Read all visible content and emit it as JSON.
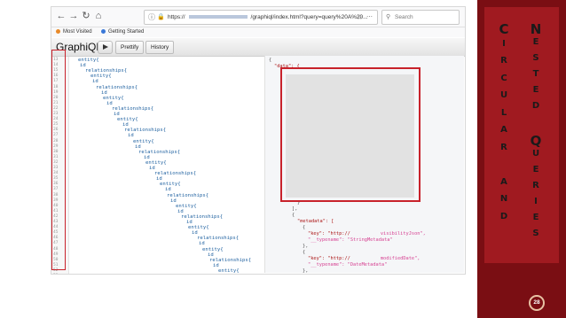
{
  "browser": {
    "url_prefix": "https://",
    "url_suffix": "/graphiql/index.html?query=query%20A%20...",
    "search_placeholder": "Search",
    "bookmarks": [
      "Most Visited",
      "Getting Started"
    ]
  },
  "graphiql": {
    "title": "GraphiQL",
    "prettify_label": "Prettify",
    "history_label": "History"
  },
  "query_lines": [
    {
      "n": "13",
      "code": "entity{"
    },
    {
      "n": "14",
      "code": "id"
    },
    {
      "n": "15",
      "code": "relationships{"
    },
    {
      "n": "16",
      "code": "entity{"
    },
    {
      "n": "17",
      "code": "id"
    },
    {
      "n": "18",
      "code": "relationships{"
    },
    {
      "n": "19",
      "code": "id"
    },
    {
      "n": "20",
      "code": "entity{"
    },
    {
      "n": "21",
      "code": "id"
    },
    {
      "n": "22",
      "code": "relationships{"
    },
    {
      "n": "23",
      "code": "id"
    },
    {
      "n": "24",
      "code": "entity{"
    },
    {
      "n": "25",
      "code": "id"
    },
    {
      "n": "26",
      "code": "relationships{"
    },
    {
      "n": "27",
      "code": "id"
    },
    {
      "n": "28",
      "code": "entity{"
    },
    {
      "n": "29",
      "code": "id"
    },
    {
      "n": "30",
      "code": "relationships{"
    },
    {
      "n": "31",
      "code": "id"
    },
    {
      "n": "32",
      "code": "entity{"
    },
    {
      "n": "33",
      "code": "id"
    },
    {
      "n": "34",
      "code": "relationships{"
    },
    {
      "n": "35",
      "code": "id"
    },
    {
      "n": "36",
      "code": "entity{"
    },
    {
      "n": "37",
      "code": "id"
    },
    {
      "n": "38",
      "code": "relationships{"
    },
    {
      "n": "39",
      "code": "id"
    },
    {
      "n": "40",
      "code": "entity{"
    },
    {
      "n": "41",
      "code": "id"
    },
    {
      "n": "42",
      "code": "relationships{"
    },
    {
      "n": "43",
      "code": "id"
    },
    {
      "n": "44",
      "code": "entity{"
    },
    {
      "n": "45",
      "code": "id"
    },
    {
      "n": "46",
      "code": "relationships{"
    },
    {
      "n": "47",
      "code": "id"
    },
    {
      "n": "48",
      "code": "entity{"
    },
    {
      "n": "49",
      "code": "id"
    },
    {
      "n": "50",
      "code": "relationships{"
    },
    {
      "n": "51",
      "code": "id"
    },
    {
      "n": "52",
      "code": "entity{"
    },
    {
      "n": "53",
      "code": "id"
    }
  ],
  "result": {
    "open_brace": "{",
    "data_key": "\"data\": {",
    "close1": "}",
    "close2": "],",
    "close3": "{",
    "metadata_key": "\"metadata\": [",
    "obj_open1": "{",
    "key1_label": "\"key\": \"http://",
    "key1_value": "visibilityJson\",",
    "typename1": "\"__typename\": \"StringMetadata\"",
    "obj_close1": "},",
    "obj_open2": "{",
    "key2_label": "\"key\": \"http://",
    "key2_value": "modifiedDate\",",
    "typename2": "\"__typename\": \"DateMetadata\"",
    "obj_close2": "},"
  },
  "side_panel": {
    "col1": [
      "C",
      "I",
      "R",
      "C",
      "U",
      "L",
      "A",
      "R",
      " ",
      "A",
      "N",
      "D"
    ],
    "col2": [
      "N",
      "E",
      "S",
      "T",
      "E",
      "D",
      " ",
      "Q",
      "U",
      "E",
      "R",
      "I",
      "E",
      "S"
    ],
    "page_number": "28"
  },
  "colors": {
    "accent_red": "#c8222b",
    "panel_dark": "#7a0e13",
    "panel_mid": "#a01a20"
  }
}
